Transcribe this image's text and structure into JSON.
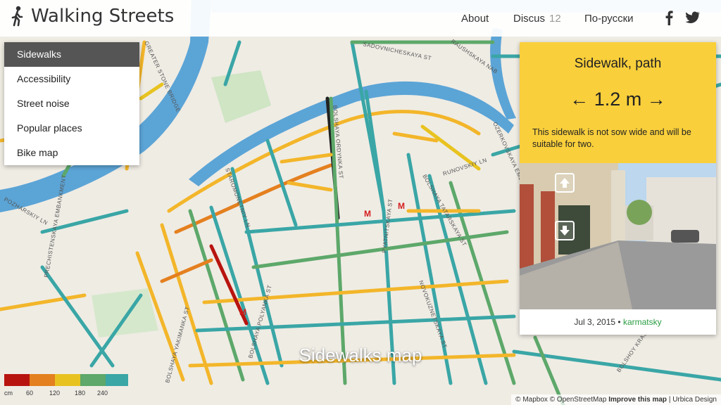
{
  "header": {
    "brand": "Walking Streets",
    "nav": {
      "about": "About",
      "discus": "Discus",
      "discus_count": "12",
      "russian": "По-русски"
    },
    "social": [
      "facebook-icon",
      "twitter-icon"
    ]
  },
  "menu": {
    "items": [
      "Sidewalks",
      "Accessibility",
      "Street noise",
      "Popular places",
      "Bike map"
    ],
    "active": "Sidewalks"
  },
  "panel": {
    "title": "Sidewalk, path",
    "width": "← 1.2 m →",
    "description": "This sidewalk is not sow wide and will be suitable for two.",
    "photo_date": "Jul 3, 2015 •",
    "photo_author": "karmatsky"
  },
  "map": {
    "title": "Sidewalks map",
    "street_labels": [
      "SADOVNICHESKAYA ST",
      "RAUSHSKAYA NAB",
      "GREATER STONE BRIDGE",
      "BOLSHAYA ORDYNKA ST",
      "STAROMONETNIY LN",
      "PYATNITSKAYA ST",
      "BOLSHAYA TATARSKAYA ST",
      "RUNOVSKIY LN",
      "SADOVNICHESKAYA ST",
      "OZERKOVSKAYA EMBANKMENT",
      "POZHARSKIY LN",
      "PRECHISTENSKAYA EMBANKMENT",
      "BOLSHAYA YAKIMANKA ST",
      "BOLSHAYA POLYANKA ST",
      "NOVOKUZNETSKAYA ST",
      "BOLSHOY KRASN"
    ],
    "metro_symbol": "M"
  },
  "legend": {
    "unit": "cm",
    "ticks": [
      "60",
      "120",
      "180",
      "240"
    ],
    "colors": [
      "#b8140f",
      "#e4801f",
      "#e8c320",
      "#5da86a",
      "#3aa6a6"
    ]
  },
  "attribution": {
    "mapbox": "© Mapbox",
    "osm": "© OpenStreetMap",
    "improve": "Improve this map",
    "urbica": "| Urbica Design"
  },
  "colors": {
    "accent": "#f9cf3b",
    "water": "#5ba4d6",
    "road_yellow": "#f3b62a",
    "road_teal": "#3aa6a6"
  }
}
